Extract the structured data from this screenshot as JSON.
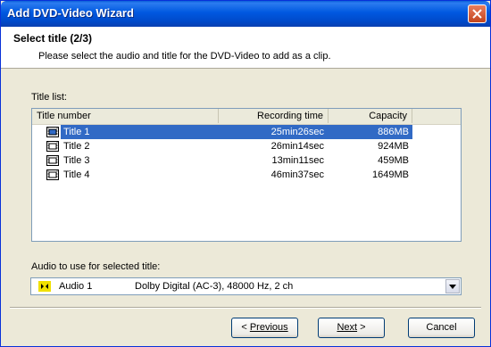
{
  "window": {
    "title": "Add DVD-Video Wizard"
  },
  "header": {
    "step_title": "Select title (2/3)",
    "description": "Please select the audio and title for the DVD-Video to add as a clip."
  },
  "title_list": {
    "label": "Title list:",
    "columns": {
      "title_number": "Title number",
      "recording_time": "Recording time",
      "capacity": "Capacity"
    },
    "rows": [
      {
        "title": "Title 1",
        "time": "25min26sec",
        "capacity": "886MB",
        "selected": true
      },
      {
        "title": "Title 2",
        "time": "26min14sec",
        "capacity": "924MB",
        "selected": false
      },
      {
        "title": "Title 3",
        "time": "13min11sec",
        "capacity": "459MB",
        "selected": false
      },
      {
        "title": "Title 4",
        "time": "46min37sec",
        "capacity": "1649MB",
        "selected": false
      }
    ]
  },
  "audio": {
    "label": "Audio to use for selected title:",
    "selected_name": "Audio 1",
    "selected_format": "Dolby Digital (AC-3), 48000 Hz, 2 ch"
  },
  "buttons": {
    "previous": "Previous",
    "next": "Next",
    "cancel": "Cancel"
  },
  "colors": {
    "titlebar": "#0058e0",
    "selection": "#316ac5",
    "dialog_bg": "#ece9d8"
  }
}
